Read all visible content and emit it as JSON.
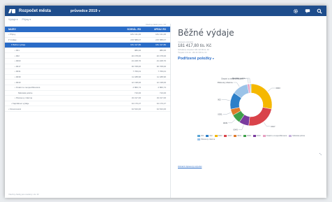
{
  "app": {
    "title": "Rozpočet města",
    "period": "průvodce 2019",
    "period_chevron": "▾"
  },
  "toolbar": {
    "icons": [
      "settings-icon",
      "chat-icon",
      "search-icon"
    ]
  },
  "filters": [
    {
      "label": "Výdaje ▾"
    },
    {
      "label": "Příjmy ▾"
    }
  ],
  "table": {
    "hint": "Všechny částky jsou v Kč",
    "columns": [
      "NÁZEV",
      "SCHVÁL. RO",
      "UPRAV. RO"
    ],
    "rows": [
      {
        "name": "• Příjmy",
        "v1": "181 131,00",
        "v2": "181 131,00",
        "level": 0,
        "selected": false
      },
      {
        "name": "▾ Výdaje",
        "v1": "215 588,07",
        "v2": "215 588,07",
        "level": 0,
        "selected": false
      },
      {
        "name": "▾ Běžné výdaje",
        "v1": "181 417,80",
        "v2": "181 417,80",
        "level": 1,
        "selected": true
      },
      {
        "name": "• 001",
        "v1": "980,00",
        "v2": "980,00",
        "level": 2,
        "selected": false
      },
      {
        "name": "• 002",
        "v1": "20 478,00",
        "v2": "20 478,00",
        "level": 2,
        "selected": false
      },
      {
        "name": "• 0003",
        "v1": "44 228,70",
        "v2": "44 228,70",
        "level": 2,
        "selected": false
      },
      {
        "name": "• 0017",
        "v1": "36 768,00",
        "v2": "36 768,00",
        "level": 2,
        "selected": false
      },
      {
        "name": "• 0031",
        "v1": "7 769,01",
        "v2": "7 769,01",
        "level": 2,
        "selected": false
      },
      {
        "name": "• 0039",
        "v1": "11 188,96",
        "v2": "11 188,96",
        "level": 2,
        "selected": false
      },
      {
        "name": "• 0043",
        "v1": "12 138,00",
        "v2": "12 138,00",
        "level": 2,
        "selected": false
      },
      {
        "name": "• Ostatní a nespecifikované",
        "v1": "2 860,74",
        "v2": "2 860,74",
        "level": 2,
        "selected": false
      },
      {
        "name": "Městská policie",
        "v1": "710,00",
        "v2": "710,00",
        "level": 3,
        "selected": false
      },
      {
        "name": "• Pěstouny zdarma",
        "v1": "19 317,00",
        "v2": "19 317,00",
        "level": 2,
        "selected": false
      },
      {
        "name": "• Kapitálové výdaje",
        "v1": "34 170,27",
        "v2": "34 170,27",
        "level": 1,
        "selected": false
      },
      {
        "name": "• Financování",
        "v1": "34 543,00",
        "v2": "34 543,00",
        "level": 0,
        "selected": false
      }
    ],
    "footnote": "Všechny částky jsou uvedeny v tis. Kč"
  },
  "detail": {
    "title": "Běžné výdaje",
    "amount_label": "Upravený rozpočet",
    "amount": "181 417,80 tis. Kč",
    "sub1": "Schválený rozpočet: 181 417,80 tis. Kč",
    "sub2": "Čerpání k 31.12.: 181 417,80 tis. Kč",
    "section_title": "Podřízené položky",
    "section_chevron": "▾",
    "bottom_link": "Zobrazit Upravený rozpočet"
  },
  "chart_data": {
    "type": "pie",
    "donut": true,
    "slices": [
      {
        "label": "0003",
        "value": 44228.7,
        "color": "#f5b800"
      },
      {
        "label": "0017",
        "value": 36768,
        "color": "#d9434a"
      },
      {
        "label": "0043",
        "value": 12138,
        "color": "#7a3b9e"
      },
      {
        "label": "0039",
        "value": 11188.96,
        "color": "#3fa14b"
      },
      {
        "label": "0031",
        "value": 7769.01,
        "color": "#e07b2c"
      },
      {
        "label": "002",
        "value": 20478,
        "color": "#2c7fc9"
      },
      {
        "label": "Pěstouny zdarma",
        "value": 19317,
        "color": "#9bc3e8"
      },
      {
        "label": "Ostatní a nespecifikované",
        "value": 2860.74,
        "color": "#e8a1c2"
      },
      {
        "label": "Městská policie",
        "value": 710,
        "color": "#c7b3de"
      },
      {
        "label": "001",
        "value": 980,
        "color": "#5aa6d6"
      }
    ],
    "callouts": [
      "Pěstouny zdarma",
      "Městská policie",
      "Ostatní a nespecifikované",
      "0031",
      "0039",
      "0043",
      "0003",
      "0017",
      "002"
    ]
  },
  "legend": [
    {
      "label": "001",
      "color": "#5aa6d6"
    },
    {
      "label": "002",
      "color": "#2c7fc9"
    },
    {
      "label": "0003",
      "color": "#f5b800"
    },
    {
      "label": "0017",
      "color": "#d9434a"
    },
    {
      "label": "0031",
      "color": "#e07b2c"
    },
    {
      "label": "0039",
      "color": "#3fa14b"
    },
    {
      "label": "0043",
      "color": "#7a3b9e"
    },
    {
      "label": "Ostatní a nespecifikované",
      "color": "#e8a1c2"
    },
    {
      "label": "Městská policie",
      "color": "#c7b3de"
    },
    {
      "label": "Pěstouny zdarma",
      "color": "#9bc3e8"
    }
  ]
}
